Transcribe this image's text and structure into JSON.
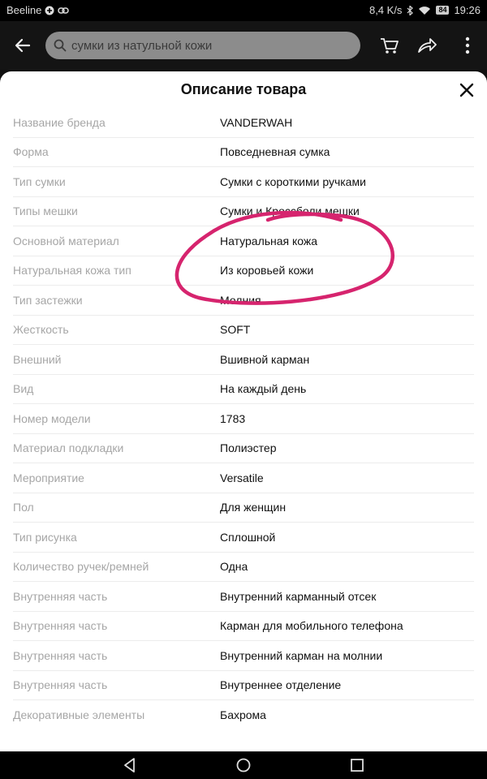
{
  "status": {
    "carrier": "Beeline",
    "speed": "8,4 K/s",
    "battery": "84",
    "time": "19:26",
    "icons": [
      "plus-circle-icon",
      "link-icon",
      "bluetooth-icon",
      "wifi-icon",
      "battery-icon"
    ]
  },
  "toolbar": {
    "search_placeholder": "сумки из натульной кожи",
    "icons": [
      "back-arrow-icon",
      "search-icon",
      "cart-icon",
      "share-icon",
      "more-icon"
    ]
  },
  "sheet": {
    "title": "Описание товара",
    "rows": [
      {
        "key": "Название бренда",
        "value": "VANDERWAH"
      },
      {
        "key": "Форма",
        "value": "Повседневная сумка"
      },
      {
        "key": "Тип сумки",
        "value": "Сумки с короткими ручками"
      },
      {
        "key": "Типы мешки",
        "value": "Сумки и Кроссболи мешки"
      },
      {
        "key": "Основной материал",
        "value": "Натуральная кожа"
      },
      {
        "key": "Натуральная кожа тип",
        "value": "Из коровьей кожи"
      },
      {
        "key": "Тип застежки",
        "value": "Молния"
      },
      {
        "key": "Жесткость",
        "value": "SOFT"
      },
      {
        "key": "Внешний",
        "value": "Вшивной карман"
      },
      {
        "key": "Вид",
        "value": "На каждый день"
      },
      {
        "key": "Номер модели",
        "value": "1783"
      },
      {
        "key": "Материал подкладки",
        "value": "Полиэстер"
      },
      {
        "key": "Мероприятие",
        "value": "Versatile"
      },
      {
        "key": "Пол",
        "value": "Для женщин"
      },
      {
        "key": "Тип рисунка",
        "value": "Сплошной"
      },
      {
        "key": "Количество ручек/ремней",
        "value": "Одна"
      },
      {
        "key": "Внутренняя часть",
        "value": "Внутренний карманный отсек"
      },
      {
        "key": "Внутренняя часть",
        "value": "Карман для мобильного телефона"
      },
      {
        "key": "Внутренняя часть",
        "value": "Внутренний карман на молнии"
      },
      {
        "key": "Внутренняя часть",
        "value": "Внутреннее отделение"
      },
      {
        "key": "Декоративные элементы",
        "value": "Бахрома"
      }
    ]
  },
  "annotation": {
    "color": "#d6246e",
    "shape": "hand-drawn-circle"
  },
  "navbar": {
    "icons": [
      "nav-back-icon",
      "nav-home-icon",
      "nav-recents-icon"
    ]
  },
  "colors": {
    "key_text": "#a6a6a6",
    "value_text": "#111111",
    "search_bg": "#8c8c8c"
  }
}
